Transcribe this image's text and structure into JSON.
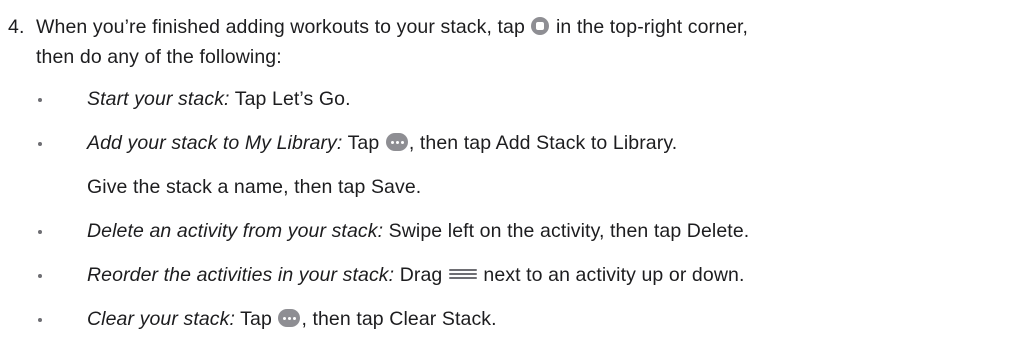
{
  "step": {
    "number": "4.",
    "line1_before_icon": "When you’re finished adding workouts to your stack, tap ",
    "line1_after_icon": " in the top-right corner,",
    "line2": "then do any of the following:"
  },
  "bullets": [
    {
      "label": "Start your stack:",
      "text_before_icon": " Tap Let’s Go.",
      "icon": "",
      "text_after_icon": ""
    },
    {
      "label": "Add your stack to My Library:",
      "text_before_icon": " Tap ",
      "icon": "more-icon",
      "text_after_icon": ", then tap Add Stack to Library."
    },
    {
      "label": "",
      "text_before_icon": "Give the stack a name, then tap Save.",
      "icon": "",
      "text_after_icon": ""
    },
    {
      "label": "Delete an activity from your stack:",
      "text_before_icon": " Swipe left on the activity, then tap Delete.",
      "icon": "",
      "text_after_icon": ""
    },
    {
      "label": "Reorder the activities in your stack:",
      "text_before_icon": " Drag ",
      "icon": "drag-handle-icon",
      "text_after_icon": " next to an activity up or down."
    },
    {
      "label": "Clear your stack:",
      "text_before_icon": " Tap ",
      "icon": "more-icon",
      "text_after_icon": ", then tap Clear Stack."
    }
  ],
  "icons": {
    "stack": "stack-icon",
    "more": "more-icon",
    "drag": "drag-handle-icon"
  }
}
